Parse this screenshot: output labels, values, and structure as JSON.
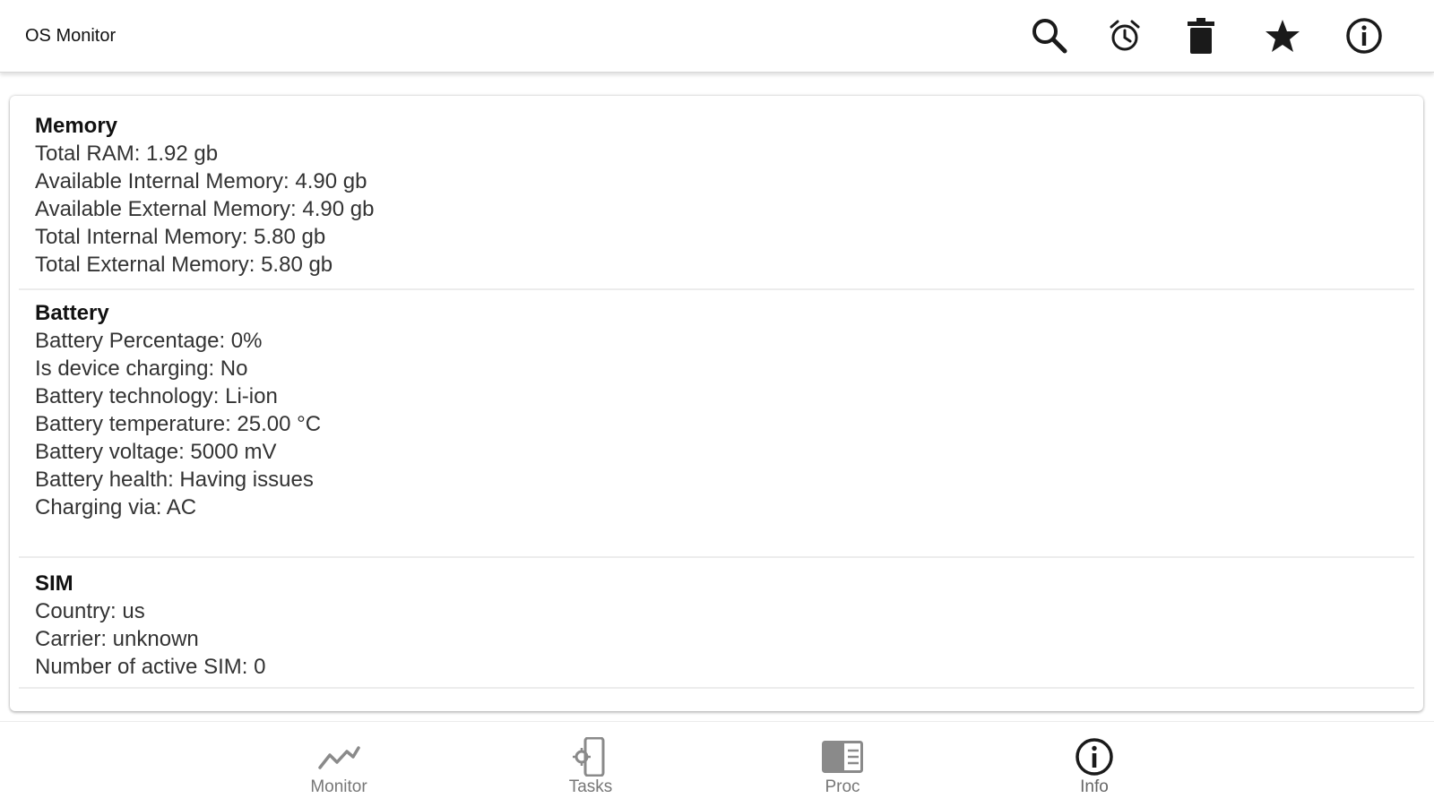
{
  "app": {
    "title": "OS Monitor"
  },
  "toolbar": {
    "actions": [
      {
        "name": "search",
        "icon": "search-icon"
      },
      {
        "name": "alarm",
        "icon": "alarm-clock-icon"
      },
      {
        "name": "delete",
        "icon": "trash-icon"
      },
      {
        "name": "favorite",
        "icon": "star-icon"
      },
      {
        "name": "info",
        "icon": "info-icon"
      }
    ]
  },
  "sections": {
    "memory": {
      "title": "Memory",
      "lines": [
        "Total RAM: 1.92 gb",
        "Available Internal Memory: 4.90 gb",
        "Available External Memory: 4.90 gb",
        "Total Internal Memory: 5.80 gb",
        "Total External Memory: 5.80 gb"
      ]
    },
    "battery": {
      "title": "Battery",
      "lines": [
        "Battery Percentage: 0%",
        "Is device charging: No",
        "Battery technology: Li-ion",
        "Battery temperature: 25.00 °C",
        "Battery voltage: 5000 mV",
        "Battery health: Having issues",
        "Charging via: AC"
      ]
    },
    "sim": {
      "title": "SIM",
      "lines": [
        "Country: us",
        "Carrier: unknown",
        "Number of active SIM: 0"
      ]
    }
  },
  "bottom_nav": {
    "items": [
      {
        "label": "Monitor",
        "icon": "line-chart-icon",
        "active": false
      },
      {
        "label": "Tasks",
        "icon": "tasks-phone-gear-icon",
        "active": false
      },
      {
        "label": "Proc",
        "icon": "process-list-icon",
        "active": false
      },
      {
        "label": "Info",
        "icon": "info-icon",
        "active": true
      }
    ]
  },
  "colors": {
    "icon_dark": "#1a1a1a",
    "icon_muted": "#8a8a8a",
    "text": "#333333"
  }
}
